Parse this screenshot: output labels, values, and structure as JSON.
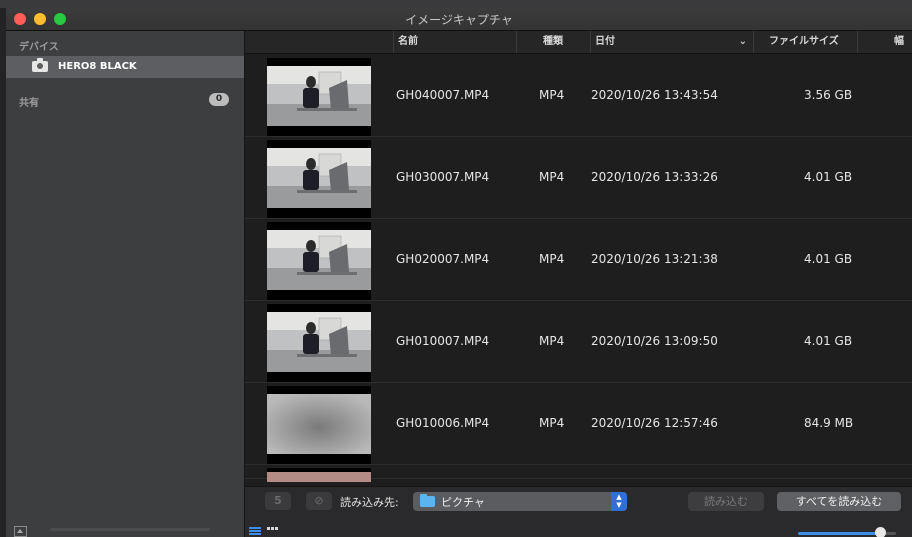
{
  "window": {
    "title": "イメージキャプチャ"
  },
  "sidebar": {
    "devices_header": "デバイス",
    "device_name": "HERO8 BLACK",
    "shared_header": "共有",
    "shared_count": "0"
  },
  "columns": {
    "name": "名前",
    "kind": "種類",
    "date": "日付",
    "size": "ファイルサイズ",
    "width": "幅"
  },
  "files": [
    {
      "name": "GH040007.MP4",
      "kind": "MP4",
      "date": "2020/10/26 13:43:54",
      "size": "3.56 GB"
    },
    {
      "name": "GH030007.MP4",
      "kind": "MP4",
      "date": "2020/10/26 13:33:26",
      "size": "4.01 GB"
    },
    {
      "name": "GH020007.MP4",
      "kind": "MP4",
      "date": "2020/10/26 13:21:38",
      "size": "4.01 GB"
    },
    {
      "name": "GH010007.MP4",
      "kind": "MP4",
      "date": "2020/10/26 13:09:50",
      "size": "4.01 GB"
    },
    {
      "name": "GH010006.MP4",
      "kind": "MP4",
      "date": "2020/10/26 12:57:46",
      "size": "84.9 MB"
    }
  ],
  "toolbar": {
    "import_to_label": "読み込み先:",
    "destination": "ピクチャ",
    "import_button": "読み込む",
    "import_all_button": "すべてを読み込む",
    "rotate_glyph": "5"
  },
  "thumbnail_size": 0.85,
  "colors": {
    "accent": "#3b8fe8",
    "folder": "#5ab4f0",
    "selection": "#5d5e61"
  },
  "icons": [
    "camera-icon",
    "folder-icon",
    "list-view-icon",
    "grid-view-icon",
    "rotate-icon",
    "delete-icon",
    "chevron-down-icon",
    "eject-icon"
  ]
}
